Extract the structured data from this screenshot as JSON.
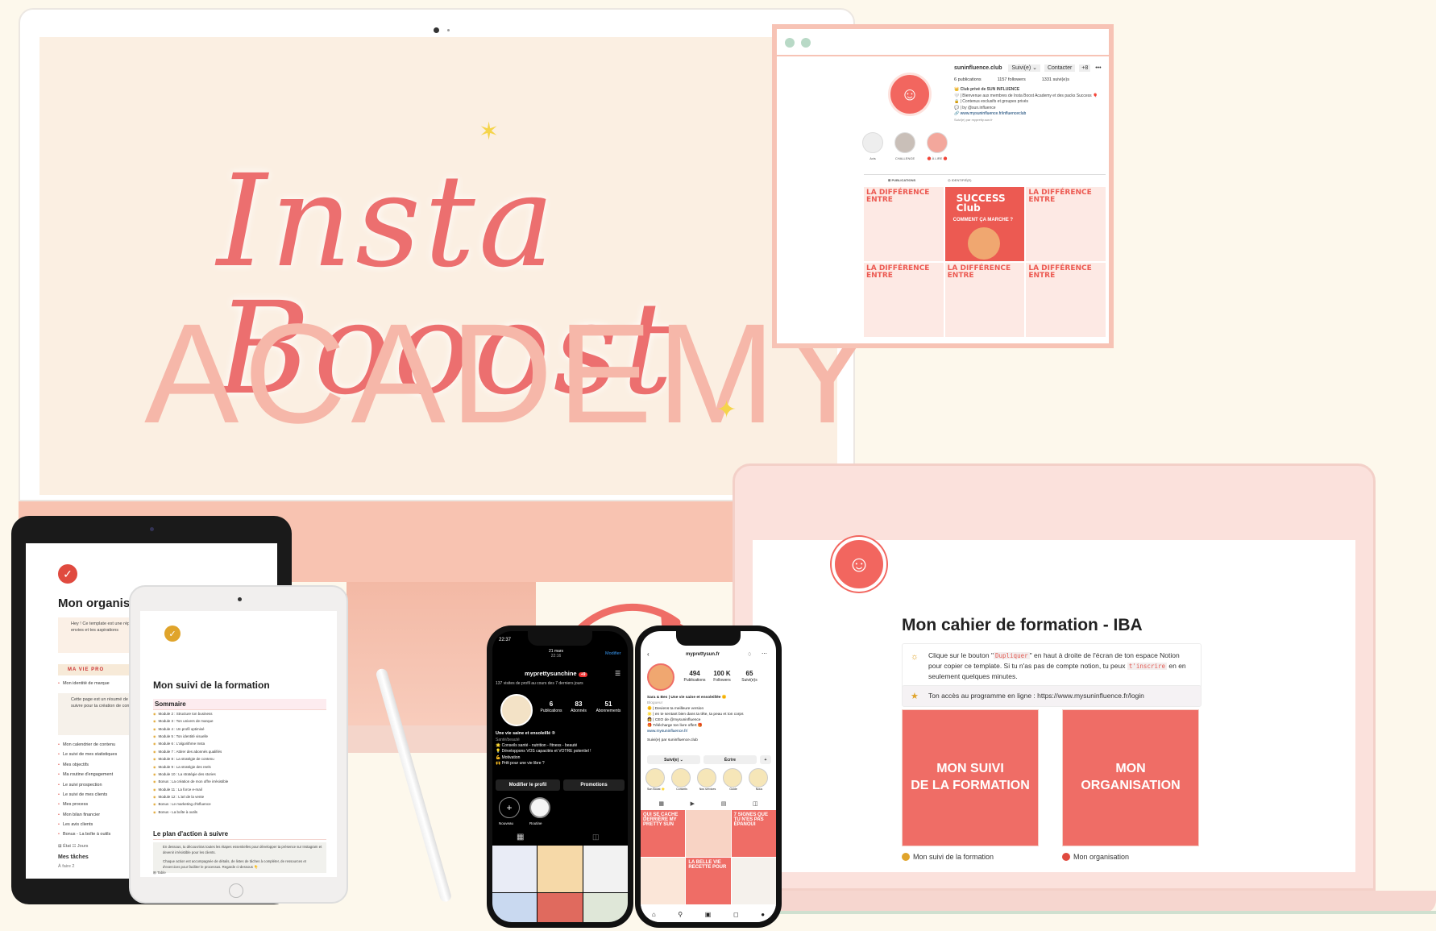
{
  "imac": {
    "script_title": "Insta Booost",
    "subtitle": "ACADEMY"
  },
  "instagram_desktop": {
    "username": "suninfluence.club",
    "follow_button": "Suivi(e) ⌄",
    "contact_button": "Contacter",
    "add_button": "+8",
    "stats": [
      "6 publications",
      "1157 followers",
      "1331 suivi(e)s"
    ],
    "bio": [
      "👑 Club privé de SUN INFLUENCE",
      "🤍 | Bienvenue aux membres de Insta Boost Academy et des packs Success 🎈",
      "🔒 | Contenus exclusifs et groupes privés",
      "💬 | by @sun.influence",
      "🔗 www.mysuninfluence.fr/influenceclub"
    ],
    "followed_by": "Suivi(e) par mypretty.sun.fr",
    "highlights": [
      "Avis",
      "CHALLENGE",
      "🔴 À LIRE 🔴"
    ],
    "tabs": [
      "⊞ PUBLICATIONS",
      "◎ IDENTIFIÉ(E)"
    ],
    "posts": [
      {
        "title": "LA DIFFÉRENCE ENTRE",
        "hot": false
      },
      {
        "title": "SUCCESS Club",
        "subtitle": "COMMENT ÇA MARCHE ?",
        "hot": true
      },
      {
        "title": "LA DIFFÉRENCE ENTRE",
        "hot": false
      },
      {
        "title": "LA DIFFÉRENCE ENTRE",
        "hot": false
      },
      {
        "title": "LA DIFFÉRENCE ENTRE",
        "hot": false
      },
      {
        "title": "LA DIFFÉRENCE ENTRE",
        "hot": false
      }
    ]
  },
  "laptop_notion": {
    "title": "Mon cahier de formation - IBA",
    "callout1_prefix": "Clique sur le bouton \"",
    "callout1_code1": "Dupliquer",
    "callout1_mid": "\" en haut à droite de l'écran de ton espace Notion pour copier ce template. Si tu n'as pas de compte notion, tu peux ",
    "callout1_code2": "t'inscrire",
    "callout1_suffix": " en en seulement quelques minutes.",
    "callout2": "Ton accès au programme en ligne : https://www.mysuninfluence.fr/login",
    "tile1": "MON SUIVI\nDE LA FORMATION",
    "tile1_caption": "Mon suivi de la formation",
    "tile2": "MON\nORGANISATION",
    "tile2_caption": "Mon organisation"
  },
  "ipad_back": {
    "title": "Mon organisati",
    "callout": "Hey ! Ce template est une réplique... suivre mes projets et gérer mon... selon tes envies et tes aspirations",
    "section": "MA VIE PRO",
    "item_top": "Mon identité de marque",
    "callout2": "Cette page est un résumé de tout ce que tu as fait durant la formation. Elle est à suivre pour ta création de contenu Instagram et la création de ses...",
    "items": [
      "Mon calendrier de contenu",
      "Le suivi de mes statistiques",
      "Mes objectifs",
      "Ma routine d'engagement",
      "Le suivi prospection",
      "Le suivi de mes clients",
      "Mes process",
      "Mon bilan financier",
      "Les avis clients",
      "Bonus - La boîte à outils"
    ],
    "view_tabs": "⊞ État   ☷ Jours",
    "tasks_title": "Mes tâches",
    "tasks_sub": "À faire  2"
  },
  "ipad_front": {
    "title": "Mon suivi de la formation",
    "summary": "Sommaire",
    "modules": [
      "Module 2 : Structure ton business",
      "Module 3 : Ton univers de marque",
      "Module 4 : Un profil optimisé",
      "Module 5 : Ton identité visuelle",
      "Module 6 : L'algorithme Insta",
      "Module 7 : Attirer des abonnés qualifiés",
      "Module 8 : La stratégie de contenu",
      "Module 9 : La stratégie des reels",
      "Module 10 : La stratégie des stories",
      "Bonus : La création de mon offre irrésistible",
      "Module 11 : La force e-mail",
      "Module 12 : L'art de la vente",
      "Bonus : Le marketing d'influence",
      "",
      "Bonus - La boîte à outils"
    ],
    "plan_title": "Le plan d'action à suivre",
    "plan_box1": "En dessous, tu découvriras toutes les étapes essentielles pour développer ta présence sur Instagram et devenir irrésistible pour les clients.",
    "plan_box2": "Chaque action est accompagnée de détails, de listes de tâches à compléter, de ressources et d'exercices pour faciliter le processus. Regarde ci-dessous 👇",
    "table_tab": "⊞ Table"
  },
  "phone_dark": {
    "time": "22:37",
    "date": "21 mars",
    "date_time": "22:16",
    "edit": "Modifier",
    "username": "myprettysunchine",
    "badge": "+9",
    "visits": "137 visites de profil au cours des 7 derniers jours",
    "stats": [
      {
        "n": "6",
        "l": "Publications"
      },
      {
        "n": "83",
        "l": "Abonnés"
      },
      {
        "n": "51",
        "l": "Abonnements"
      }
    ],
    "bio_title": "Une vie saine et ensoleillé ®",
    "bio_sub": "Santé/beauté",
    "bio": [
      "🌟 Conseils santé - nutrition - fitness - beauté",
      "💡 Développons VOS capacités et VOTRE potentiel !",
      "💪 Motivation",
      "🙌 Prêt pour une vie libre ?"
    ],
    "btn_edit": "Modifier le profil",
    "btn_promo": "Promotions",
    "hl_new": "Nouveau",
    "hl_routine": "Routine"
  },
  "phone_light": {
    "username": "myprettysun.fr",
    "stats": [
      {
        "n": "494",
        "l": "Publications"
      },
      {
        "n": "100 K",
        "l": "Followers"
      },
      {
        "n": "65",
        "l": "Suivi(e)s"
      }
    ],
    "bio_title": "Sara & Bes | Une vie saine et ensoleillée 🌞",
    "bio_sub": "Blogueur",
    "bio": [
      "🌞 | Deviens ta meilleure version",
      "🌟 | en te sentant bien dans ta tête, ta peau et ton corps",
      "👩 | CEO de @mysuninfluence",
      "🎁 Télécharge ton livre offert 🎁",
      "www.mysuninfluence.fr/"
    ],
    "followed": "Suivi(e) par suninfluence.club",
    "btn_follow": "Suivi(e) ⌄",
    "btn_write": "Écrire",
    "highlights": [
      "Sun Boost 🌟",
      "Conseils",
      "Nos services",
      "Guide",
      "Nous"
    ],
    "posts": [
      "QUI SE CACHE DERRIÈRE MY PRETTY SUN",
      "",
      "7 SIGNES QUE TU N'ES PAS ÉPANOUI",
      "",
      "LA BELLE VIE RECETTE POUR",
      ""
    ]
  },
  "colors": {
    "coral": "#ef6d66",
    "peach": "#f8c3b1",
    "cream": "#fdf8ec",
    "gold": "#e0a42b"
  }
}
